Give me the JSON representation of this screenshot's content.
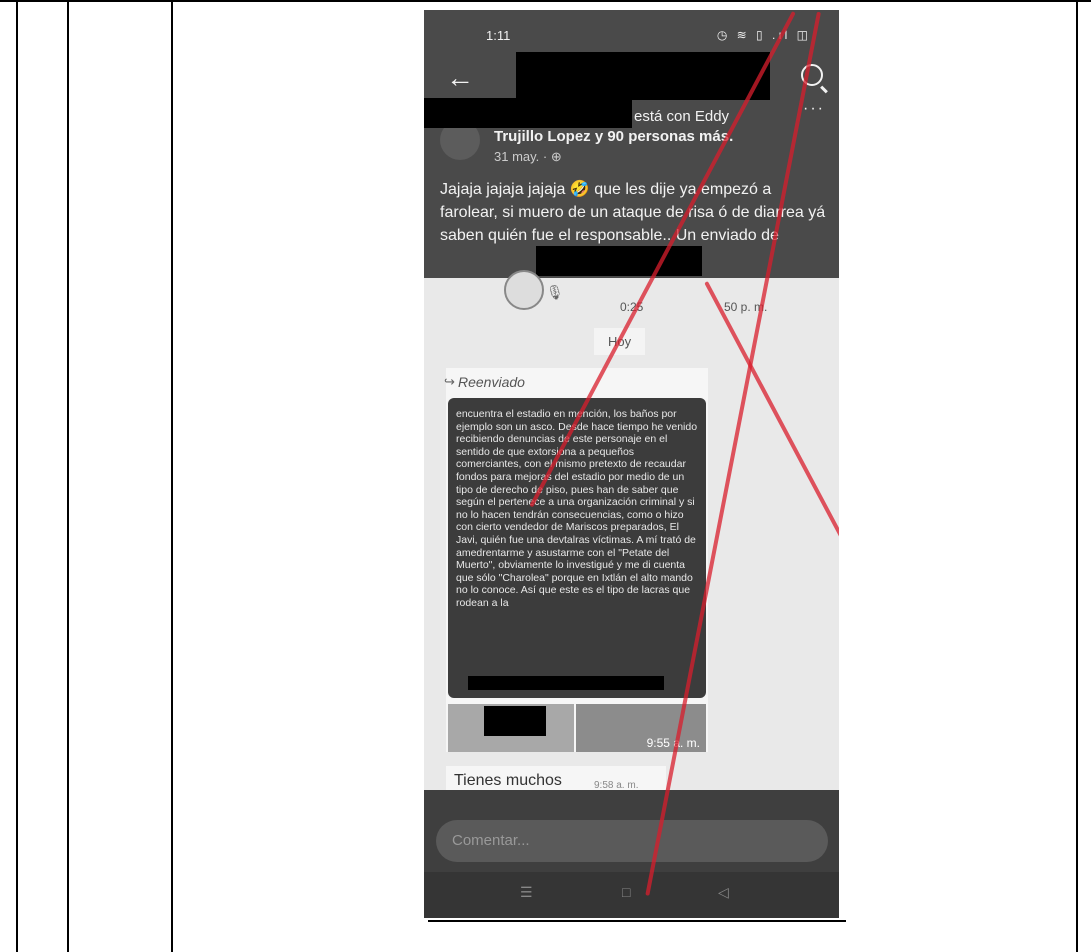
{
  "status_bar": {
    "time": "1:11",
    "icons": "◷ ≋ ▯ .ıl ◫"
  },
  "post": {
    "actor_suffix": "está con Eddy",
    "actor_line2": "Trujillo Lopez y 90 personas más.",
    "date": "31 may. · ⊕",
    "more": "···",
    "text": "Jajaja jajaja jajaja 🤣 que les dije ya empezó a farolear, si muero de un ataque de risa ó de diarrea yá saben quién fue el responsable.. Un enviado de"
  },
  "chat": {
    "voice_duration": "0:25",
    "voice_time": "50 p. m.",
    "date_chip": "Hoy",
    "forwarded_label": "Reenviado",
    "forwarded_text": "encuentra el estadio en mención, los baños por ejemplo son un asco. Desde hace tiempo he venido recibiendo denuncias de este personaje en el sentido de que extorsiona a pequeños comerciantes, con el mismo pretexto de recaudar fondos para mejoras del estadio por medio de un tipo de derecho de piso, pues han de saber que según el pertenece a una organización criminal y si no lo hacen tendrán consecuencias, como o hizo con cierto vendedor de Mariscos preparados, El Javi, quién fue una devtalras víctimas. A mí trató de amedrentarme y asustarme con el \"Petate del Muerto\", obviamente lo investigué y me di cuenta que sólo \"Charolea\" porque en Ixtlán el alto mando no lo conoce. Así que este es el tipo de lacras que rodean a la",
    "image_time": "9:55 a. m.",
    "next_message": "Tienes muchos",
    "next_message_time": "9:58 a. m."
  },
  "composer": {
    "placeholder": "Comentar..."
  },
  "nav": {
    "recents": "☰",
    "home": "□",
    "back": "◁"
  },
  "colors": {
    "red_marker": "#d81e2c"
  }
}
